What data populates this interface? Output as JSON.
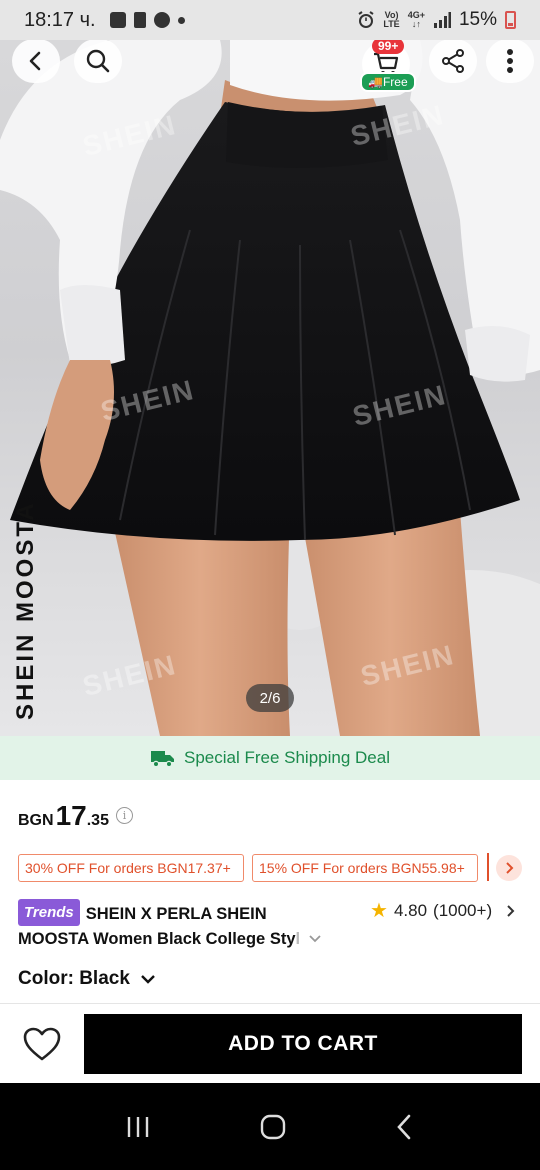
{
  "status_bar": {
    "time": "18:17 ч.",
    "network_top": "Vo)",
    "network_bottom": "LTE",
    "net2_top": "4G+",
    "net2_bottom": "↓↑",
    "battery": "15%"
  },
  "gallery": {
    "watermark": "SHEIN",
    "brand_vertical": "SHEIN MOOSTA",
    "pager": "2/6"
  },
  "header": {
    "cart_badge": "99+",
    "free_tag": "Free"
  },
  "shipping": {
    "text": "Special Free Shipping Deal"
  },
  "price": {
    "currency": "BGN",
    "integer": "17",
    "decimal": ".35",
    "info": "i"
  },
  "coupons": [
    {
      "label": "30% OFF For orders BGN17.37+"
    },
    {
      "label": "15% OFF For orders BGN55.98+"
    }
  ],
  "product": {
    "badge": "Trends",
    "title_line1": "SHEIN X PERLA SHEIN",
    "title_line2": "MOOSTA Women Black College Sty",
    "title_fade": "l",
    "rating": "4.80",
    "review_count": "(1000+)"
  },
  "color": {
    "label": "Color: Black"
  },
  "actions": {
    "add_to_cart": "ADD TO CART"
  },
  "colors": {
    "shipping_green": "#1b8a4c",
    "coupon_red": "#e0502b",
    "trends_purple": "#8a5ad8",
    "cart_badge_red": "#e8343a"
  }
}
